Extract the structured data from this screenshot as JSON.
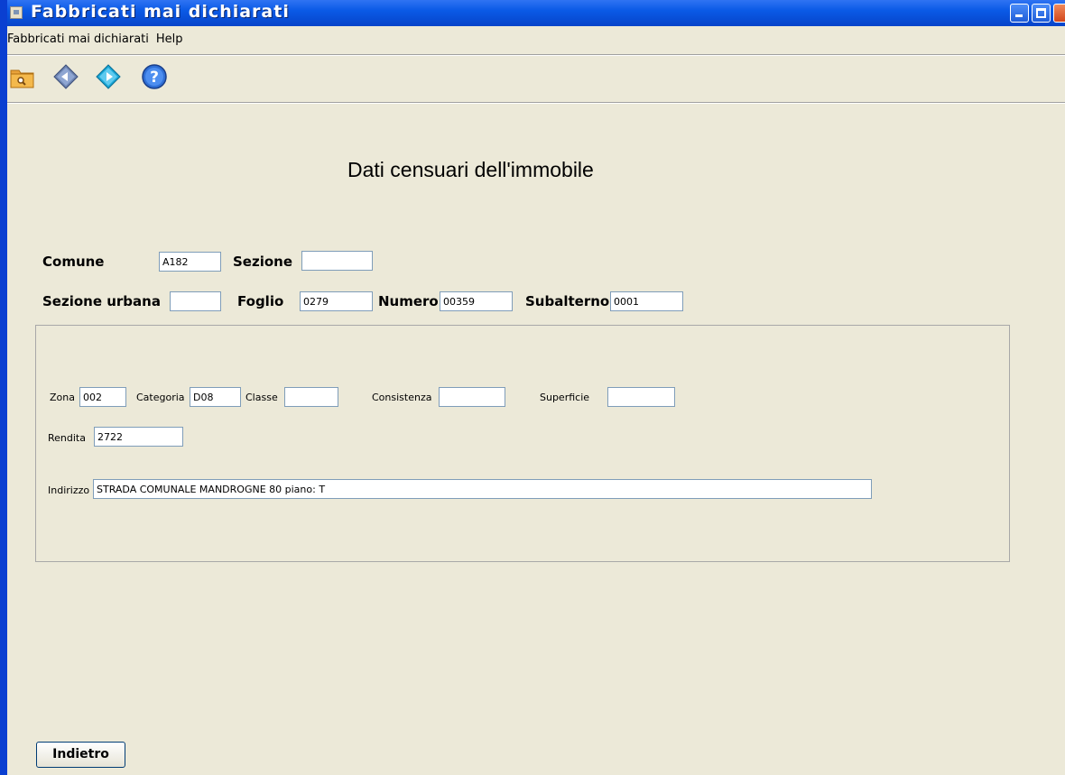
{
  "window": {
    "title": "Fabbricati mai dichiarati"
  },
  "menu": {
    "items": [
      "Fabbricati mai dichiarati",
      "Help"
    ]
  },
  "toolbar": {
    "icons": [
      "folder-search-icon",
      "diamond-back-icon",
      "diamond-forward-icon",
      "help-icon"
    ]
  },
  "heading": "Dati censuari dell'immobile",
  "form": {
    "comune": {
      "label": "Comune",
      "value": "A182"
    },
    "sezione": {
      "label": "Sezione",
      "value": ""
    },
    "sezione_urbana": {
      "label": "Sezione urbana",
      "value": ""
    },
    "foglio": {
      "label": "Foglio",
      "value": "0279"
    },
    "numero": {
      "label": "Numero",
      "value": "00359"
    },
    "subalterno": {
      "label": "Subalterno",
      "value": "0001"
    }
  },
  "details": {
    "zona": {
      "label": "Zona",
      "value": "002"
    },
    "categoria": {
      "label": "Categoria",
      "value": "D08"
    },
    "classe": {
      "label": "Classe",
      "value": ""
    },
    "consistenza": {
      "label": "Consistenza",
      "value": ""
    },
    "superficie": {
      "label": "Superficie",
      "value": ""
    },
    "rendita": {
      "label": "Rendita",
      "value": "2722"
    },
    "indirizzo": {
      "label": "Indirizzo",
      "value": "STRADA COMUNALE MANDROGNE  80 piano: T"
    }
  },
  "buttons": {
    "back": "Indietro"
  }
}
